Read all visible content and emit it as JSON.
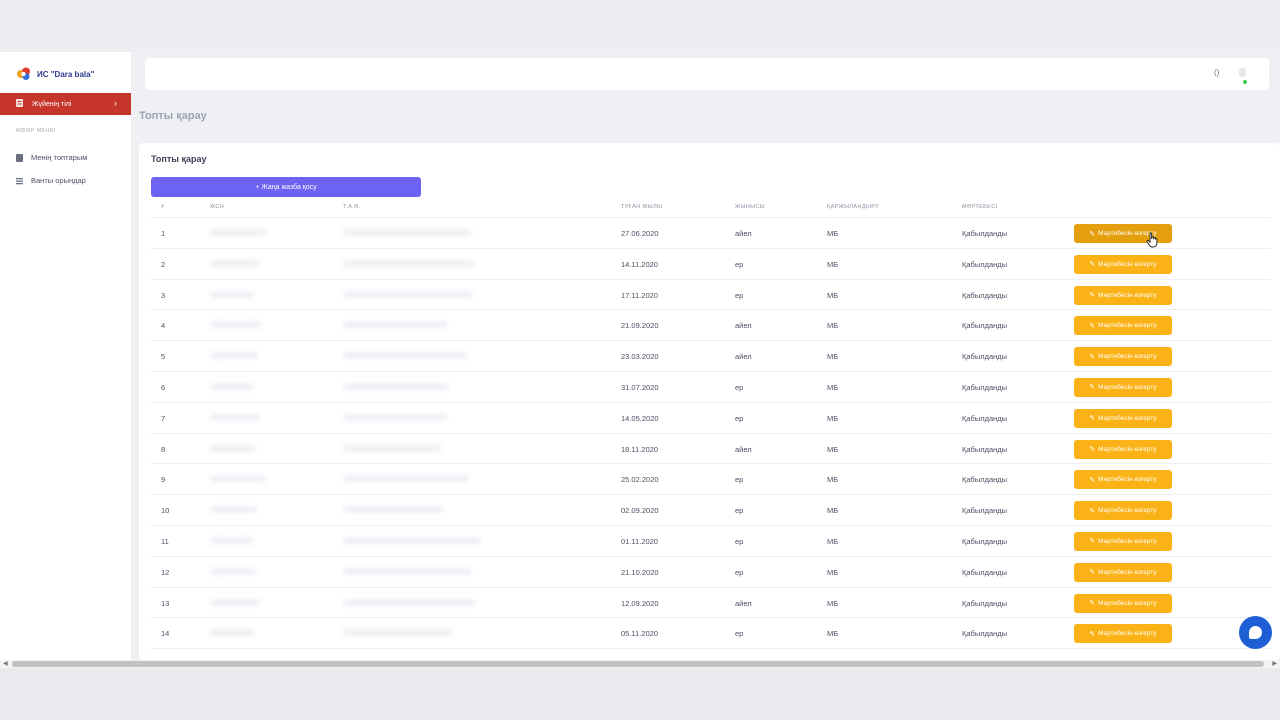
{
  "brand": {
    "name": "ИС \"Dara bala\""
  },
  "sidebar": {
    "language_item": {
      "label": "Жүйенің тілі",
      "chevron": "›"
    },
    "section_title": "МӘЗІР МЕНЮ",
    "links": [
      {
        "label": "Менің топтарым",
        "icon": "document-icon"
      },
      {
        "label": "Ванты орындар",
        "icon": "list-icon"
      }
    ]
  },
  "topbar": {
    "paren_text": "()"
  },
  "page": {
    "title": "Топты қарау"
  },
  "card": {
    "title": "Топты қарау",
    "add_button": {
      "icon": "+",
      "label": "Жаңа жазба қосу"
    },
    "columns": [
      "#",
      "ЖСН",
      "Т.А.Ә.",
      "ТУҒАН ЖЫЛЫ",
      "ЖЫНЫСЫ",
      "ҚАРЖЫЛАНДЫРУ",
      "МӘРТЕБЕСІ"
    ],
    "action_label": "Мәртебесін өзгерту",
    "rows": [
      {
        "num": "1",
        "birth": "27.06.2020",
        "gender": "айел",
        "funding": "МБ",
        "status": "Қабылданды"
      },
      {
        "num": "2",
        "birth": "14.11.2020",
        "gender": "ер",
        "funding": "МБ",
        "status": "Қабылданды"
      },
      {
        "num": "3",
        "birth": "17.11.2020",
        "gender": "ер",
        "funding": "МБ",
        "status": "Қабылданды"
      },
      {
        "num": "4",
        "birth": "21.09.2020",
        "gender": "айел",
        "funding": "МБ",
        "status": "Қабылданды"
      },
      {
        "num": "5",
        "birth": "23.03.2020",
        "gender": "айел",
        "funding": "МБ",
        "status": "Қабылданды"
      },
      {
        "num": "6",
        "birth": "31.07.2020",
        "gender": "ер",
        "funding": "МБ",
        "status": "Қабылданды"
      },
      {
        "num": "7",
        "birth": "14.05.2020",
        "gender": "ер",
        "funding": "МБ",
        "status": "Қабылданды"
      },
      {
        "num": "8",
        "birth": "18.11.2020",
        "gender": "айел",
        "funding": "МБ",
        "status": "Қабылданды"
      },
      {
        "num": "9",
        "birth": "25.02.2020",
        "gender": "ер",
        "funding": "МБ",
        "status": "Қабылданды"
      },
      {
        "num": "10",
        "birth": "02.09.2020",
        "gender": "ер",
        "funding": "МБ",
        "status": "Қабылданды"
      },
      {
        "num": "11",
        "birth": "01.11.2020",
        "gender": "ер",
        "funding": "МБ",
        "status": "Қабылданды"
      },
      {
        "num": "12",
        "birth": "21.10.2020",
        "gender": "ер",
        "funding": "МБ",
        "status": "Қабылданды"
      },
      {
        "num": "13",
        "birth": "12.09.2020",
        "gender": "айел",
        "funding": "МБ",
        "status": "Қабылданды"
      },
      {
        "num": "14",
        "birth": "05.11.2020",
        "gender": "ер",
        "funding": "МБ",
        "status": "Қабылданды"
      }
    ]
  },
  "colors": {
    "sidebar_active": "#c53529",
    "primary": "#6c63f2",
    "warning": "#fbb216",
    "chat": "#1f5fd6"
  },
  "icons": {
    "pencil": "✎",
    "chat": "chat-bubble-icon",
    "cursor": "hand-pointer-icon"
  }
}
